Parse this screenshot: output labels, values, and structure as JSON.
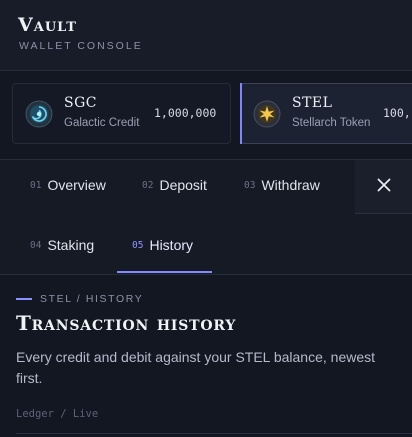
{
  "brand": {
    "title": "Vault",
    "subtitle": "WALLET CONSOLE"
  },
  "tokens": [
    {
      "symbol": "SGC",
      "name": "Galactic Credit",
      "balance": "1,000,000",
      "selected": false,
      "icon": "swirl-galaxy-icon"
    },
    {
      "symbol": "STEL",
      "name": "Stellarch Token",
      "balance": "100,",
      "selected": true,
      "icon": "star-burst-icon"
    }
  ],
  "tabs": [
    {
      "num": "01",
      "label": "Overview"
    },
    {
      "num": "02",
      "label": "Deposit"
    },
    {
      "num": "03",
      "label": "Withdraw"
    },
    {
      "num": "04",
      "label": "Staking"
    },
    {
      "num": "05",
      "label": "History",
      "active": true
    }
  ],
  "close_icon": "close-icon",
  "section": {
    "breadcrumb": "STEL / HISTORY",
    "title": "Transaction history",
    "description": "Every credit and debit against your STEL balance, newest first.",
    "ledger_label": "Ledger / Live"
  },
  "colors": {
    "accent": "#8389ff",
    "background": "#151a25",
    "panel": "#121722"
  }
}
